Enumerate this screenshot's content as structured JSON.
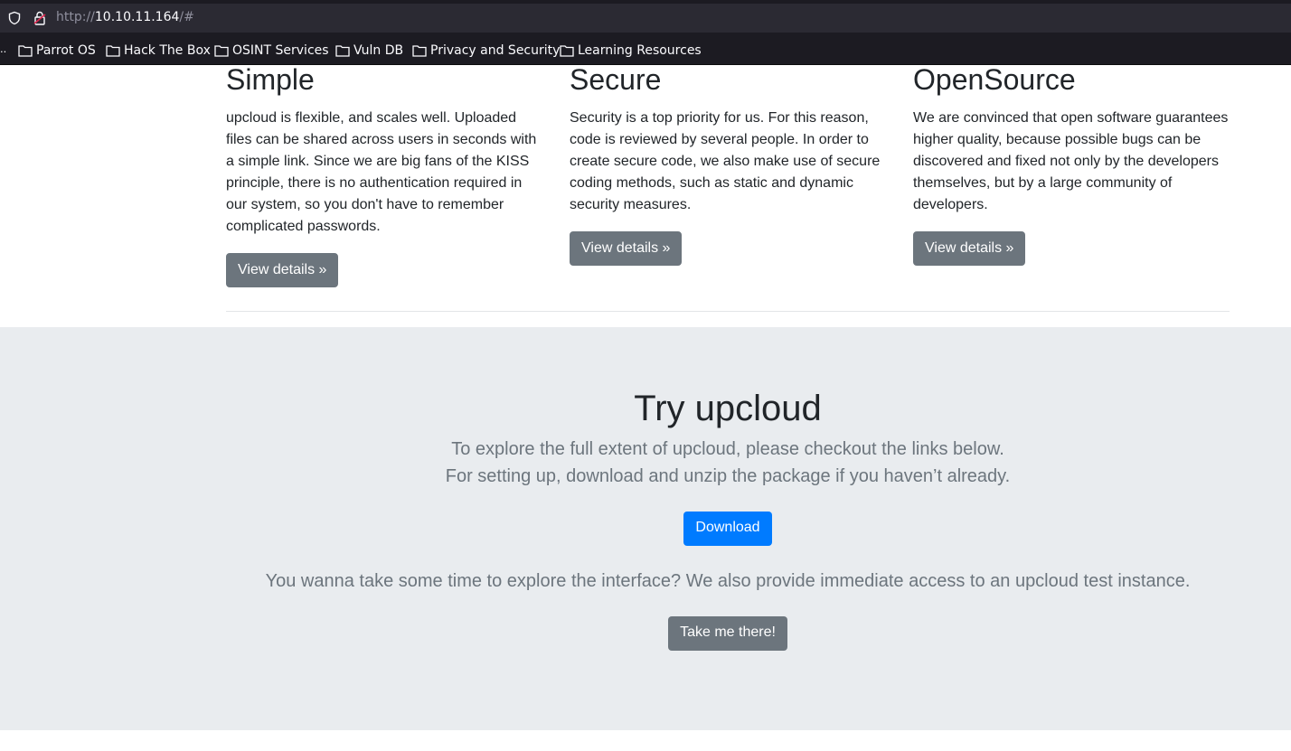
{
  "browser": {
    "url_scheme": "http://",
    "url_host": "10.10.11.164",
    "url_path": "/#",
    "bookmarks_overflow": "..",
    "bookmarks": [
      {
        "label": "Parrot OS"
      },
      {
        "label": "Hack The Box"
      },
      {
        "label": "OSINT Services"
      },
      {
        "label": "Vuln DB"
      },
      {
        "label": "Privacy and Security"
      },
      {
        "label": "Learning Resources"
      }
    ]
  },
  "features": [
    {
      "title": "Simple",
      "text": "upcloud is flexible, and scales well. Uploaded files can be shared across users in seconds with a simple link. Since we are big fans of the KISS principle, there is no authentication required in our system, so you don't have to remember complicated passwords.",
      "button": "View details »"
    },
    {
      "title": "Secure",
      "text": "Security is a top priority for us. For this reason, code is reviewed by several people. In order to create secure code, we also make use of secure coding methods, such as static and dynamic security measures.",
      "button": "View details »"
    },
    {
      "title": "OpenSource",
      "text": "We are convinced that open software guarantees higher quality, because possible bugs can be discovered and fixed not only by the developers themselves, but by a large community of developers.",
      "button": "View details »"
    }
  ],
  "try": {
    "title": "Try upcloud",
    "line1": "To explore the full extent of upcloud, please checkout the links below.",
    "line2": "For setting up, download and unzip the package if you haven’t already.",
    "download_button": "Download",
    "line3": "You wanna take some time to explore the interface? We also provide immediate access to an upcloud test instance.",
    "take_button": "Take me there!"
  },
  "colors": {
    "primary": "#007bff",
    "secondary": "#6c757d",
    "jumbotron_bg": "#e9ecef"
  },
  "icons": [
    "shield-icon",
    "lock-icon",
    "folder-icon"
  ]
}
